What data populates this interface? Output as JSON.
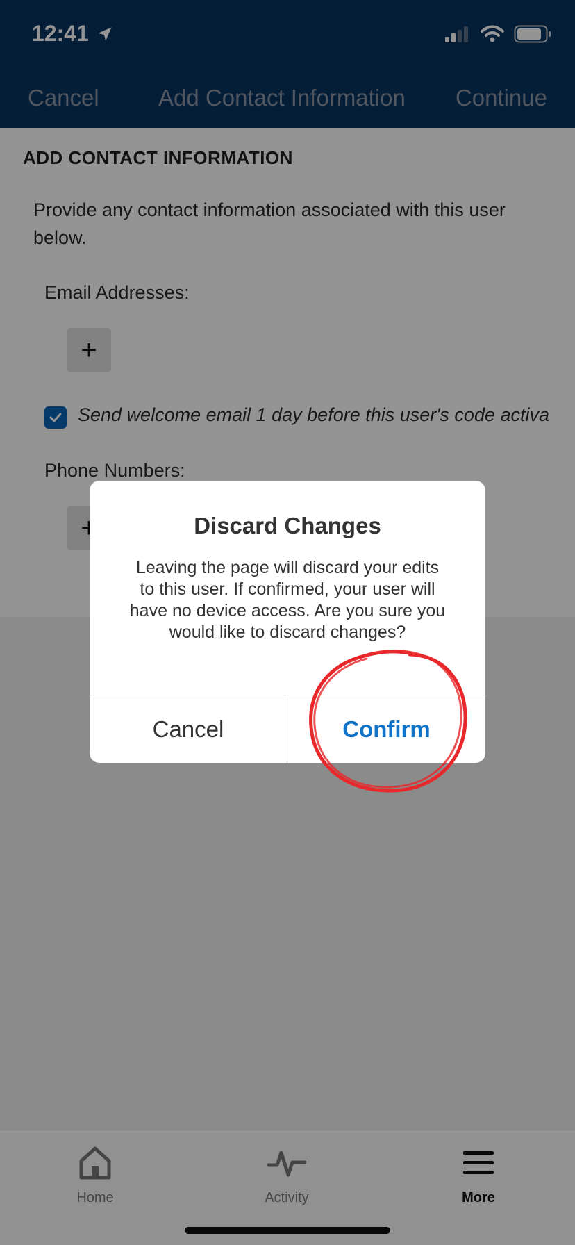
{
  "status_bar": {
    "time": "12:41"
  },
  "nav": {
    "cancel": "Cancel",
    "title": "Add Contact Information",
    "continue": "Continue"
  },
  "content": {
    "section_title": "ADD CONTACT INFORMATION",
    "description": "Provide any contact information associated with this user below.",
    "email_label": "Email Addresses:",
    "plus_symbol": "+",
    "welcome_email_label": "Send welcome email 1 day before this user's code activa",
    "welcome_email_checked": true,
    "phone_label": "Phone Numbers:"
  },
  "dialog": {
    "title": "Discard Changes",
    "message": "Leaving the page will discard your edits to this user. If confirmed, your user will have no device access. Are you sure you would like to discard changes?",
    "cancel": "Cancel",
    "confirm": "Confirm"
  },
  "tabs": [
    {
      "label": "Home",
      "icon": "home-icon"
    },
    {
      "label": "Activity",
      "icon": "activity-icon"
    },
    {
      "label": "More",
      "icon": "menu-icon",
      "selected": true
    }
  ],
  "colors": {
    "header": "#0a3461",
    "accent": "#1073c7",
    "annotation": "#e8282b"
  }
}
